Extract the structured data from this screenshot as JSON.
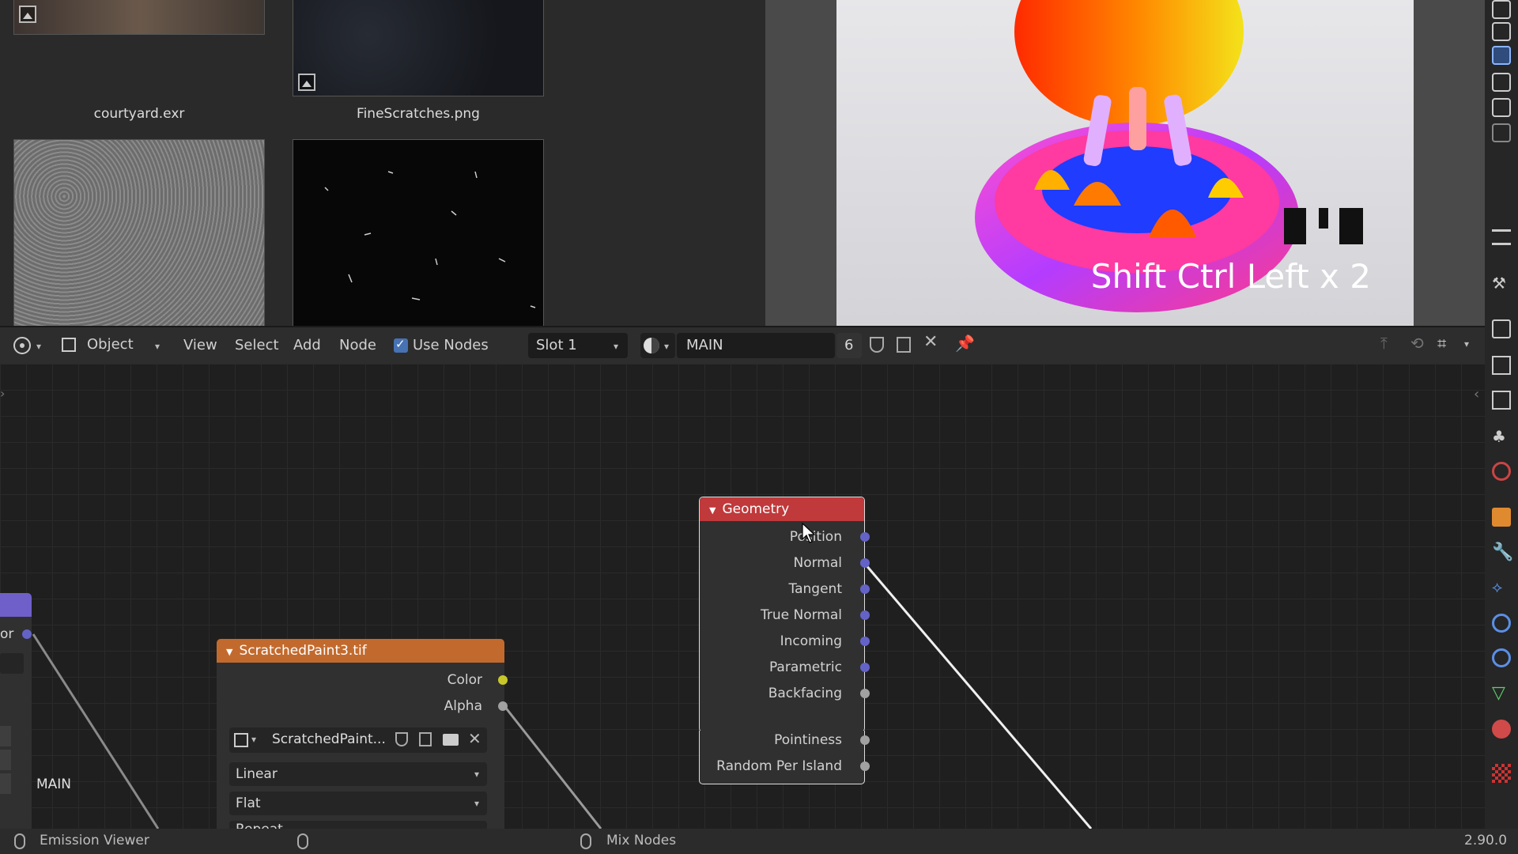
{
  "file_browser": {
    "items": [
      {
        "name": "courtyard.exr"
      },
      {
        "name": "FineScratches.png"
      },
      {
        "name": ""
      },
      {
        "name": ""
      }
    ]
  },
  "viewport": {
    "key_overlay": "Shift Ctrl Left x 2"
  },
  "header": {
    "editor_type_icon": "node-editor-icon",
    "mode": "Object",
    "menus": [
      "View",
      "Select",
      "Add",
      "Node"
    ],
    "use_nodes_label": "Use Nodes",
    "use_nodes_checked": true,
    "slot": "Slot 1",
    "material_name": "MAIN",
    "user_count": "6"
  },
  "nodes": {
    "geometry": {
      "title": "Geometry",
      "header_color": "#c0393b",
      "outputs": [
        "Position",
        "Normal",
        "Tangent",
        "True Normal",
        "Incoming",
        "Parametric",
        "Backfacing",
        "Pointiness",
        "Random Per Island"
      ]
    },
    "image_texture": {
      "title": "ScratchedPaint3.tif",
      "header_color": "#c26a2e",
      "outputs": [
        "Color",
        "Alpha"
      ],
      "image_name": "ScratchedPaint...",
      "interpolation": "Linear",
      "projection": "Flat",
      "extension": "Repeat"
    },
    "left_partial": {
      "socket_label": "or",
      "material_label": "MAIN",
      "header_color": "#6f5fc9"
    }
  },
  "statusbar": {
    "left": "Emission Viewer",
    "middle": "Mix Nodes",
    "version": "2.90.0"
  },
  "colors": {
    "accent": "#4772b3",
    "socket_vector": "#6363c7",
    "socket_float": "#a1a1a1",
    "socket_color": "#c7c729"
  }
}
